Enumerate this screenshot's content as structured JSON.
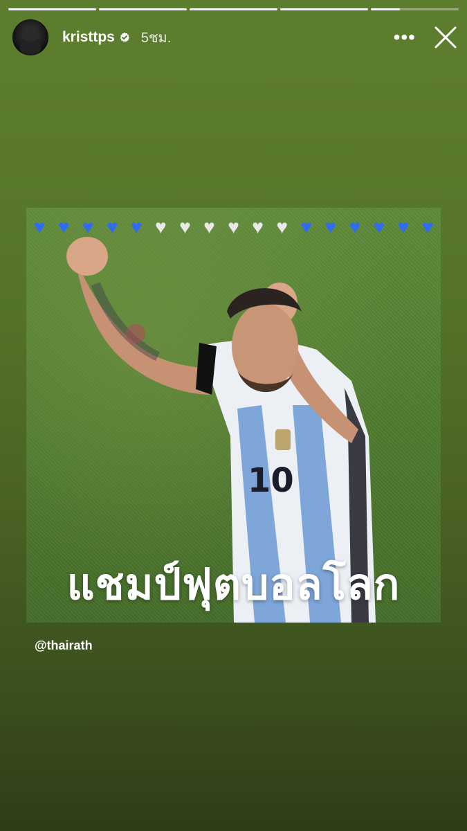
{
  "story": {
    "progress": [
      1,
      1,
      1,
      1,
      0.33
    ],
    "user": {
      "username": "kristtps",
      "verified": true,
      "time": "5ชม."
    },
    "more_label": "•••"
  },
  "post": {
    "hearts": [
      "blue",
      "blue",
      "blue",
      "blue",
      "blue",
      "white",
      "white",
      "white",
      "white",
      "white",
      "white",
      "blue",
      "blue",
      "blue",
      "blue",
      "blue",
      "blue"
    ],
    "caption": "แชมป์ฟุตบอลโลก",
    "mention": "@thairath"
  }
}
